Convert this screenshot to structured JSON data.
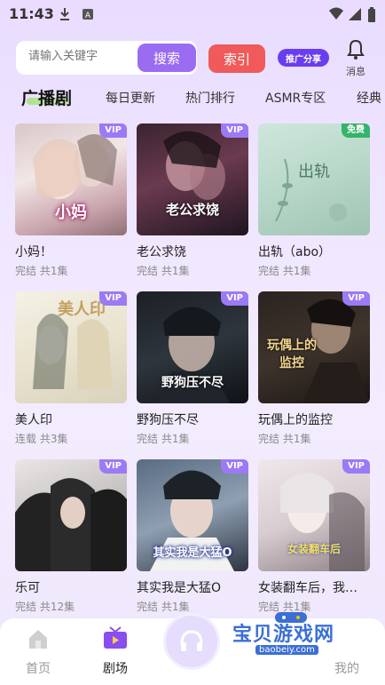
{
  "status": {
    "time": "11:43"
  },
  "search": {
    "placeholder": "请输入关键字",
    "search_label": "搜索",
    "index_label": "索引",
    "promo_label": "推广分享",
    "notice_label": "消息"
  },
  "tabs": [
    "广播剧",
    "每日更新",
    "热门排行",
    "ASMR专区",
    "经典"
  ],
  "colors": {
    "accent": "#9b6bf2",
    "index": "#f05a5a",
    "promo": "#6a3df0",
    "vip_badge": "#9c7af5",
    "free_badge": "#35b36a"
  },
  "cards": [
    {
      "title": "小妈！",
      "meta": "完结 共1集",
      "badge": "VIP",
      "cover_text": "小妈"
    },
    {
      "title": "老公求饶",
      "meta": "完结 共1集",
      "badge": "VIP",
      "cover_text": "老公求饶"
    },
    {
      "title": "出轨（abo）",
      "meta": "完结 共1集",
      "badge": "免费",
      "cover_text": "出轨"
    },
    {
      "title": "美人印",
      "meta": "连载 共3集",
      "badge": "VIP",
      "cover_text": "美人印"
    },
    {
      "title": "野狗压不尽",
      "meta": "完结 共1集",
      "badge": "VIP",
      "cover_text": "野狗压不尽"
    },
    {
      "title": "玩偶上的监控",
      "meta": "完结 共1集",
      "badge": "VIP",
      "cover_text": "玩偶上的监控"
    },
    {
      "title": "乐可",
      "meta": "完结 共12集",
      "badge": "VIP",
      "cover_text": ""
    },
    {
      "title": "其实我是大猛O",
      "meta": "完结 共1集",
      "badge": "VIP",
      "cover_text": "其实我是大猛O"
    },
    {
      "title": "女装翻车后，我…",
      "meta": "完结 共1集",
      "badge": "VIP",
      "cover_text": "女装翻车后"
    }
  ],
  "nav": {
    "home": "首页",
    "theater": "剧场",
    "mine": "我的"
  },
  "watermark": {
    "text": "宝贝游戏网",
    "sub": "baobeiy.com"
  }
}
